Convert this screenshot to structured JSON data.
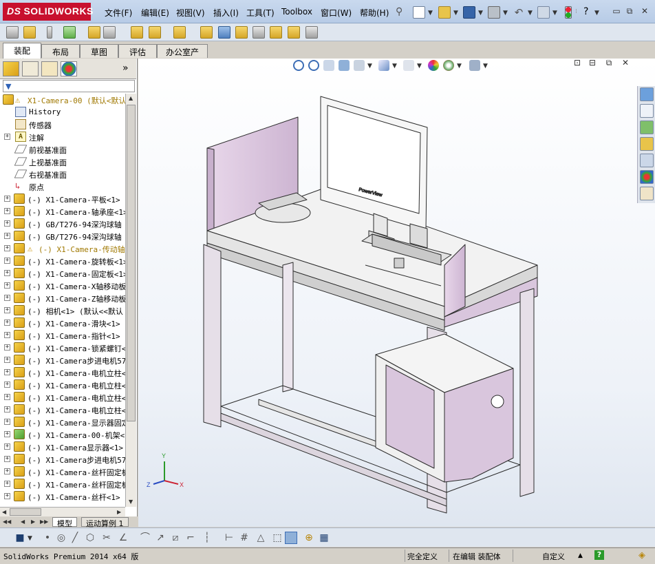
{
  "app": {
    "brand_ds": "DS",
    "brand": "SOLIDWORKS"
  },
  "menu": [
    "文件(F)",
    "编辑(E)",
    "视图(V)",
    "插入(I)",
    "工具(T)",
    "Toolbox",
    "窗口(W)",
    "帮助(H)"
  ],
  "help_label": "?",
  "tabs": [
    "装配体",
    "布局",
    "草图",
    "评估",
    "办公室产品"
  ],
  "active_tab": "装配体",
  "panel": {
    "chevron": "»",
    "filter_icon": "funnel-icon",
    "root": {
      "label": "X1-Camera-00  (默认<默认",
      "warning": true
    },
    "items": [
      {
        "icon": "history-icon",
        "label": "History",
        "expandable": false
      },
      {
        "icon": "sensor-icon",
        "label": "传感器",
        "expandable": false
      },
      {
        "icon": "annotation-icon",
        "label": "注解",
        "expandable": true
      },
      {
        "icon": "plane-icon",
        "label": "前视基准面",
        "expandable": false
      },
      {
        "icon": "plane-icon",
        "label": "上视基准面",
        "expandable": false
      },
      {
        "icon": "plane-icon",
        "label": "右视基准面",
        "expandable": false
      },
      {
        "icon": "origin-icon",
        "label": "原点",
        "expandable": false
      },
      {
        "icon": "part-icon",
        "label": "(-) X1-Camera-平板<1>  (",
        "expandable": true
      },
      {
        "icon": "part-icon",
        "label": "(-) X1-Camera-轴承座<1>",
        "expandable": true
      },
      {
        "icon": "part-icon",
        "label": "(-) GB/T276-94深沟球轴",
        "expandable": true
      },
      {
        "icon": "part-icon",
        "label": "(-) GB/T276-94深沟球轴",
        "expandable": true
      },
      {
        "icon": "part-icon",
        "label": "(-) X1-Camera-传动轴",
        "expandable": true,
        "warning": true
      },
      {
        "icon": "part-icon",
        "label": "(-) X1-Camera-旋转板<1>",
        "expandable": true
      },
      {
        "icon": "part-icon",
        "label": "(-) X1-Camera-固定板<1>",
        "expandable": true
      },
      {
        "icon": "part-icon",
        "label": "(-) X1-Camera-X轴移动板",
        "expandable": true
      },
      {
        "icon": "part-icon",
        "label": "(-) X1-Camera-Z轴移动板",
        "expandable": true
      },
      {
        "icon": "part-icon",
        "label": "(-) 相机<1>  (默认<<默认",
        "expandable": true
      },
      {
        "icon": "part-icon",
        "label": "(-) X1-Camera-滑块<1>  (",
        "expandable": true
      },
      {
        "icon": "part-icon",
        "label": "(-) X1-Camera-指针<1>  (",
        "expandable": true
      },
      {
        "icon": "part-icon",
        "label": "(-) X1-Camera-锁紧螺钉<",
        "expandable": true
      },
      {
        "icon": "part-icon",
        "label": "(-) X1-Camera步进电机57",
        "expandable": true
      },
      {
        "icon": "part-icon",
        "label": "(-) X1-Camera-电机立柱<",
        "expandable": true
      },
      {
        "icon": "part-icon",
        "label": "(-) X1-Camera-电机立柱<",
        "expandable": true
      },
      {
        "icon": "part-icon",
        "label": "(-) X1-Camera-电机立柱<",
        "expandable": true
      },
      {
        "icon": "part-icon",
        "label": "(-) X1-Camera-电机立柱<",
        "expandable": true
      },
      {
        "icon": "part-icon",
        "label": "(-) X1-Camera-显示器固定",
        "expandable": true
      },
      {
        "icon": "part-icon-green",
        "label": "(-) X1-Camera-00-机架<1",
        "expandable": true
      },
      {
        "icon": "part-icon",
        "label": "(-) X1-Camera显示器<1>",
        "expandable": true
      },
      {
        "icon": "part-icon",
        "label": "(-) X1-Camera步进电机57",
        "expandable": true
      },
      {
        "icon": "part-icon",
        "label": "(-) X1-Camera-丝杆固定板",
        "expandable": true
      },
      {
        "icon": "part-icon",
        "label": "(-) X1-Camera-丝杆固定板",
        "expandable": true
      },
      {
        "icon": "part-icon",
        "label": "(-) X1-Camera-丝杆<1>  (",
        "expandable": true
      }
    ]
  },
  "bottom_tabs": [
    "模型",
    "运动算例 1"
  ],
  "viewport": {
    "monitor_brand": "PowerView",
    "triad": {
      "x": "X",
      "y": "Y",
      "z": "Z"
    }
  },
  "status": {
    "product": "SolidWorks Premium 2014 x64 版",
    "definition": "完全定义",
    "editing": "在编辑 装配体",
    "units": "自定义",
    "units_arrow": "▲",
    "help_icon": "?"
  },
  "colors": {
    "accent": "#c8102e",
    "panel_lilac": "#d9c6dd",
    "frame": "#3a3a3a"
  }
}
